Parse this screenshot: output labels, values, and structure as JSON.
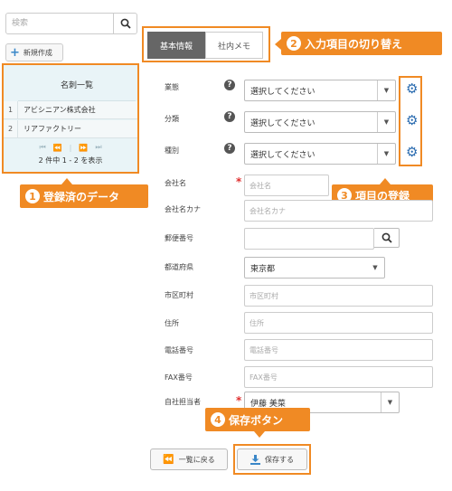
{
  "search": {
    "placeholder": "検索"
  },
  "new_button": {
    "label": "新規作成"
  },
  "list": {
    "header": "名刺一覧",
    "rows": [
      {
        "num": "1",
        "name": "アビシニアン株式会社"
      },
      {
        "num": "2",
        "name": "リアファクトリー"
      }
    ],
    "pager_info": "2 件中 1 - 2 を表示"
  },
  "tabs": [
    {
      "label": "基本情報",
      "active": true
    },
    {
      "label": "社内メモ",
      "active": false
    }
  ],
  "callouts": {
    "c1": {
      "num": "1",
      "text": "登録済のデータ"
    },
    "c2": {
      "num": "2",
      "text": "入力項目の切り替え"
    },
    "c3": {
      "num": "3",
      "text": "項目の登録"
    },
    "c4": {
      "num": "4",
      "text": "保存ボタン"
    }
  },
  "form": {
    "gyotai": {
      "label": "業態",
      "value": "選択してください"
    },
    "bunrui": {
      "label": "分類",
      "value": "選択してください"
    },
    "shubetsu": {
      "label": "種別",
      "value": "選択してください"
    },
    "company": {
      "label": "会社名",
      "placeholder": "会社名"
    },
    "company_kana": {
      "label": "会社名カナ",
      "placeholder": "会社名カナ"
    },
    "zip": {
      "label": "郵便番号",
      "placeholder": ""
    },
    "prefecture": {
      "label": "都道府県",
      "value": "東京都"
    },
    "city": {
      "label": "市区町村",
      "placeholder": "市区町村"
    },
    "address": {
      "label": "住所",
      "placeholder": "住所"
    },
    "phone": {
      "label": "電話番号",
      "placeholder": "電話番号"
    },
    "fax": {
      "label": "FAX番号",
      "placeholder": "FAX番号"
    },
    "owner": {
      "label": "自社担当者",
      "value": "伊藤 美菜"
    }
  },
  "buttons": {
    "back": "一覧に戻る",
    "save": "保存する"
  },
  "colors": {
    "accent": "#f08a24",
    "gear": "#2b6cb0",
    "active_tab": "#666666"
  }
}
